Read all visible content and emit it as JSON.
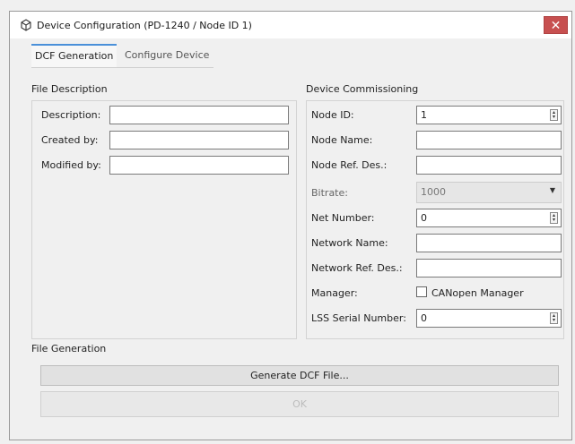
{
  "window": {
    "title": "Device Configuration (PD-1240 / Node ID 1)",
    "close_glyph": "✕",
    "icon": "device-icon"
  },
  "tabs": [
    {
      "label": "DCF Generation",
      "active": true
    },
    {
      "label": "Configure Device",
      "active": false
    }
  ],
  "file_description": {
    "label": "File Description",
    "rows": [
      {
        "label": "Description:",
        "value": ""
      },
      {
        "label": "Created by:",
        "value": ""
      },
      {
        "label": "Modified by:",
        "value": ""
      }
    ]
  },
  "commissioning": {
    "label": "Device Commissioning",
    "node_id": {
      "label": "Node ID:",
      "value": "1"
    },
    "node_name": {
      "label": "Node Name:",
      "value": ""
    },
    "node_ref": {
      "label": "Node Ref. Des.:",
      "value": ""
    },
    "bitrate": {
      "label": "Bitrate:",
      "value": "1000"
    },
    "net_number": {
      "label": "Net Number:",
      "value": "0"
    },
    "network_name": {
      "label": "Network Name:",
      "value": ""
    },
    "network_ref": {
      "label": "Network Ref. Des.:",
      "value": ""
    },
    "manager": {
      "label": "Manager:",
      "checkbox_label": "CANopen Manager",
      "checked": false
    },
    "lss_serial": {
      "label": "LSS Serial Number:",
      "value": "0"
    }
  },
  "file_generation": {
    "label": "File Generation",
    "generate_button": "Generate DCF File...",
    "ok_button": "OK"
  },
  "colors": {
    "close_button": "#c75050",
    "tab_accent": "#4a90d9"
  }
}
